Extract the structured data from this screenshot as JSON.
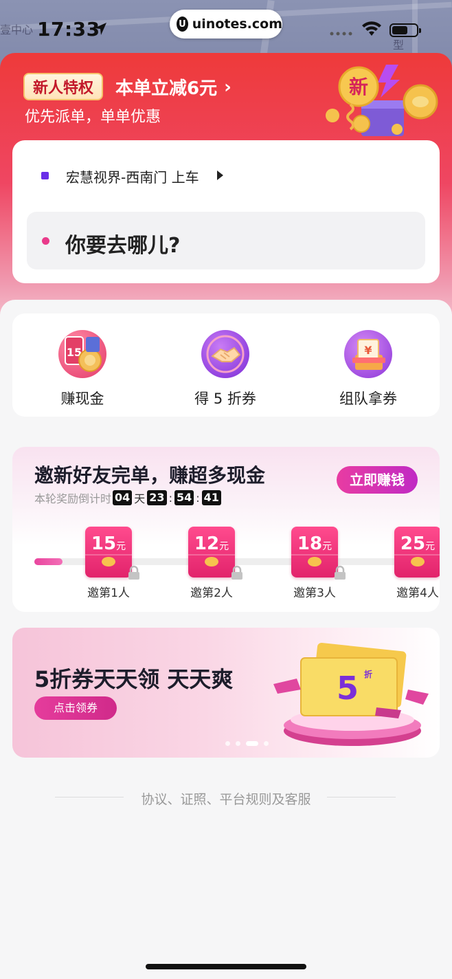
{
  "status_bar": {
    "time": "17:33",
    "url": "uinotes.com",
    "url_logo": "U"
  },
  "map": {
    "labels": [
      "壹中心",
      "型"
    ]
  },
  "promo": {
    "badge": "新人特权",
    "title": "本单立减6元",
    "subtitle": "优先派单，单单优惠",
    "illus_text": "新"
  },
  "address": {
    "pickup": "宏慧视界-西南门 上车",
    "destination_placeholder": "你要去哪儿?"
  },
  "quick_actions": [
    {
      "label": "赚现金",
      "icon": "cash-coins-icon"
    },
    {
      "label": "得 5 折券",
      "icon": "handshake-icon"
    },
    {
      "label": "组队拿券",
      "icon": "coupon-box-icon"
    }
  ],
  "invite": {
    "title": "邀新好友完单，赚超多现金",
    "countdown_label": "本轮奖励倒计时",
    "days": "04",
    "day_unit": "天",
    "hours": "23",
    "minutes": "54",
    "seconds": "41",
    "button": "立即赚钱",
    "progress": 0.07,
    "currency": "元",
    "rewards": [
      {
        "amount": "15",
        "label": "邀第1人"
      },
      {
        "amount": "12",
        "label": "邀第2人"
      },
      {
        "amount": "18",
        "label": "邀第3人"
      },
      {
        "amount": "25",
        "label": "邀第4人"
      }
    ]
  },
  "banner": {
    "title": "5折券天天领 天天爽",
    "button": "点击领券",
    "coupon_value": "5",
    "coupon_unit": "折",
    "active_slide": 3,
    "slide_count": 4
  },
  "footer": {
    "text": "协议、证照、平台规则及客服"
  }
}
